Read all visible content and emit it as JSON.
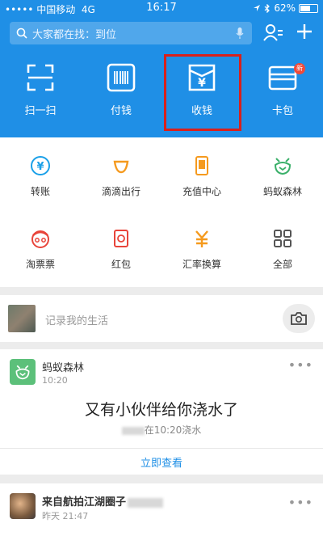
{
  "status_bar": {
    "carrier": "••••• 中国移动",
    "network": "4G",
    "time": "16:17",
    "battery": "62%",
    "battery_level": 0.62
  },
  "search": {
    "placeholder": "大家都在找：到位"
  },
  "quick_actions": [
    {
      "label": "扫一扫",
      "icon": "scan-icon"
    },
    {
      "label": "付钱",
      "icon": "barcode-icon"
    },
    {
      "label": "收钱",
      "icon": "receive-money-icon"
    },
    {
      "label": "卡包",
      "icon": "card-wallet-icon",
      "badge": "新"
    }
  ],
  "services": [
    {
      "label": "转账",
      "icon": "transfer-icon",
      "color": "#1aa0e8"
    },
    {
      "label": "滴滴出行",
      "icon": "didi-icon",
      "color": "#f59a1e"
    },
    {
      "label": "充值中心",
      "icon": "phone-recharge-icon",
      "color": "#f59a1e"
    },
    {
      "label": "蚂蚁森林",
      "icon": "ant-forest-icon",
      "color": "#3bb06a"
    },
    {
      "label": "淘票票",
      "icon": "taopiaopiao-icon",
      "color": "#e8443a"
    },
    {
      "label": "红包",
      "icon": "red-packet-icon",
      "color": "#e8443a"
    },
    {
      "label": "汇率换算",
      "icon": "exchange-rate-icon",
      "color": "#f59a1e"
    },
    {
      "label": "全部",
      "icon": "all-grid-icon",
      "color": "#555555"
    }
  ],
  "post_bar": {
    "placeholder": "记录我的生活"
  },
  "feed_card": {
    "title": "蚂蚁森林",
    "time": "10:20",
    "headline": "又有小伙伴给你浇水了",
    "sub": "在10:20浇水",
    "action": "立即查看"
  },
  "feed_card2": {
    "title": "来自航拍江湖圈子",
    "time": "昨天 21:47"
  }
}
